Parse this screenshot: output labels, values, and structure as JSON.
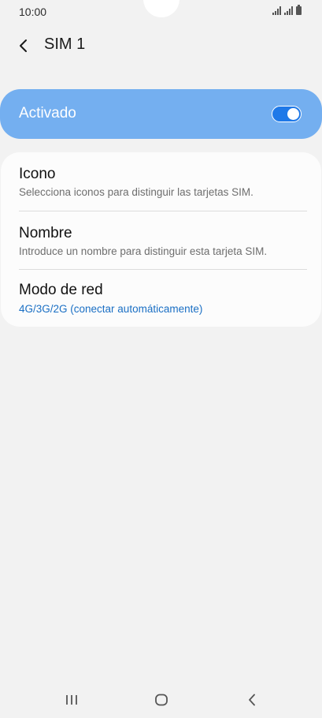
{
  "status_bar": {
    "time": "10:00"
  },
  "header": {
    "title": "SIM 1",
    "back_icon": "chevron-left-icon"
  },
  "main_switch": {
    "label": "Activado",
    "state": "on",
    "color": "#74aff0"
  },
  "settings": [
    {
      "title": "Icono",
      "subtitle": "Selecciona iconos para distinguir las tarjetas SIM."
    },
    {
      "title": "Nombre",
      "subtitle": "Introduce un nombre para distinguir esta tarjeta SIM."
    },
    {
      "title": "Modo de red",
      "subtitle": "4G/3G/2G (conectar automáticamente)"
    }
  ],
  "navigation": {
    "recents_icon": "recents-icon",
    "home_icon": "home-icon",
    "back_icon": "back-icon"
  },
  "colors": {
    "background": "#f2f2f2",
    "accent_text": "#1a6fc4",
    "toggle_on": "#1f79e8"
  }
}
